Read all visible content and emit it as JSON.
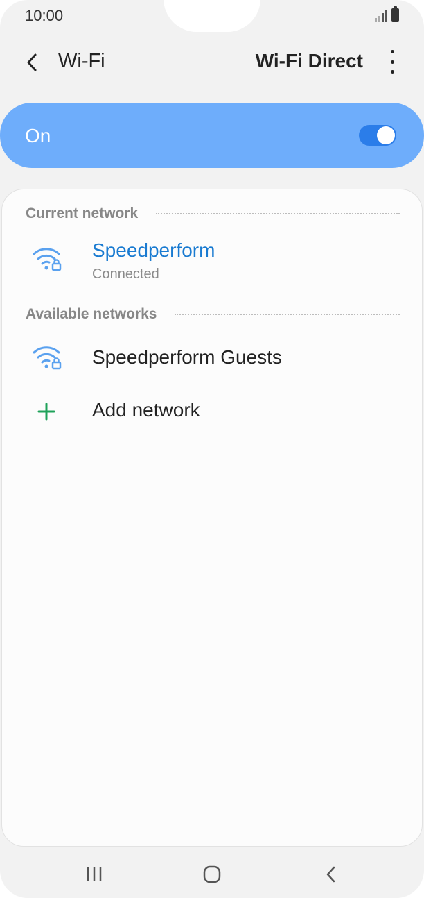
{
  "status_bar": {
    "time": "10:00",
    "icons": [
      "signal-icon",
      "battery-icon"
    ]
  },
  "header": {
    "back_icon": "back-arrow-icon",
    "title": "Wi-Fi",
    "wifi_direct_label": "Wi-Fi Direct",
    "more_icon": "more-options-icon"
  },
  "toggle": {
    "label": "On",
    "state": "on",
    "bar_color": "#6eadfb",
    "switch_color": "#2b7de9"
  },
  "current_network": {
    "section_title": "Current network",
    "network": {
      "name": "Speedperform",
      "status": "Connected",
      "icon": "wifi-locked-icon",
      "name_color": "#1a7bd1"
    }
  },
  "available_networks": {
    "section_title": "Available networks",
    "items": [
      {
        "name": "Speedperform Guests",
        "icon": "wifi-locked-icon"
      }
    ],
    "add_network": {
      "label": "Add network",
      "icon": "plus-icon",
      "icon_color": "#1fa25a"
    }
  },
  "nav_bar": {
    "buttons": [
      "recent-apps-icon",
      "home-icon",
      "back-icon"
    ]
  }
}
